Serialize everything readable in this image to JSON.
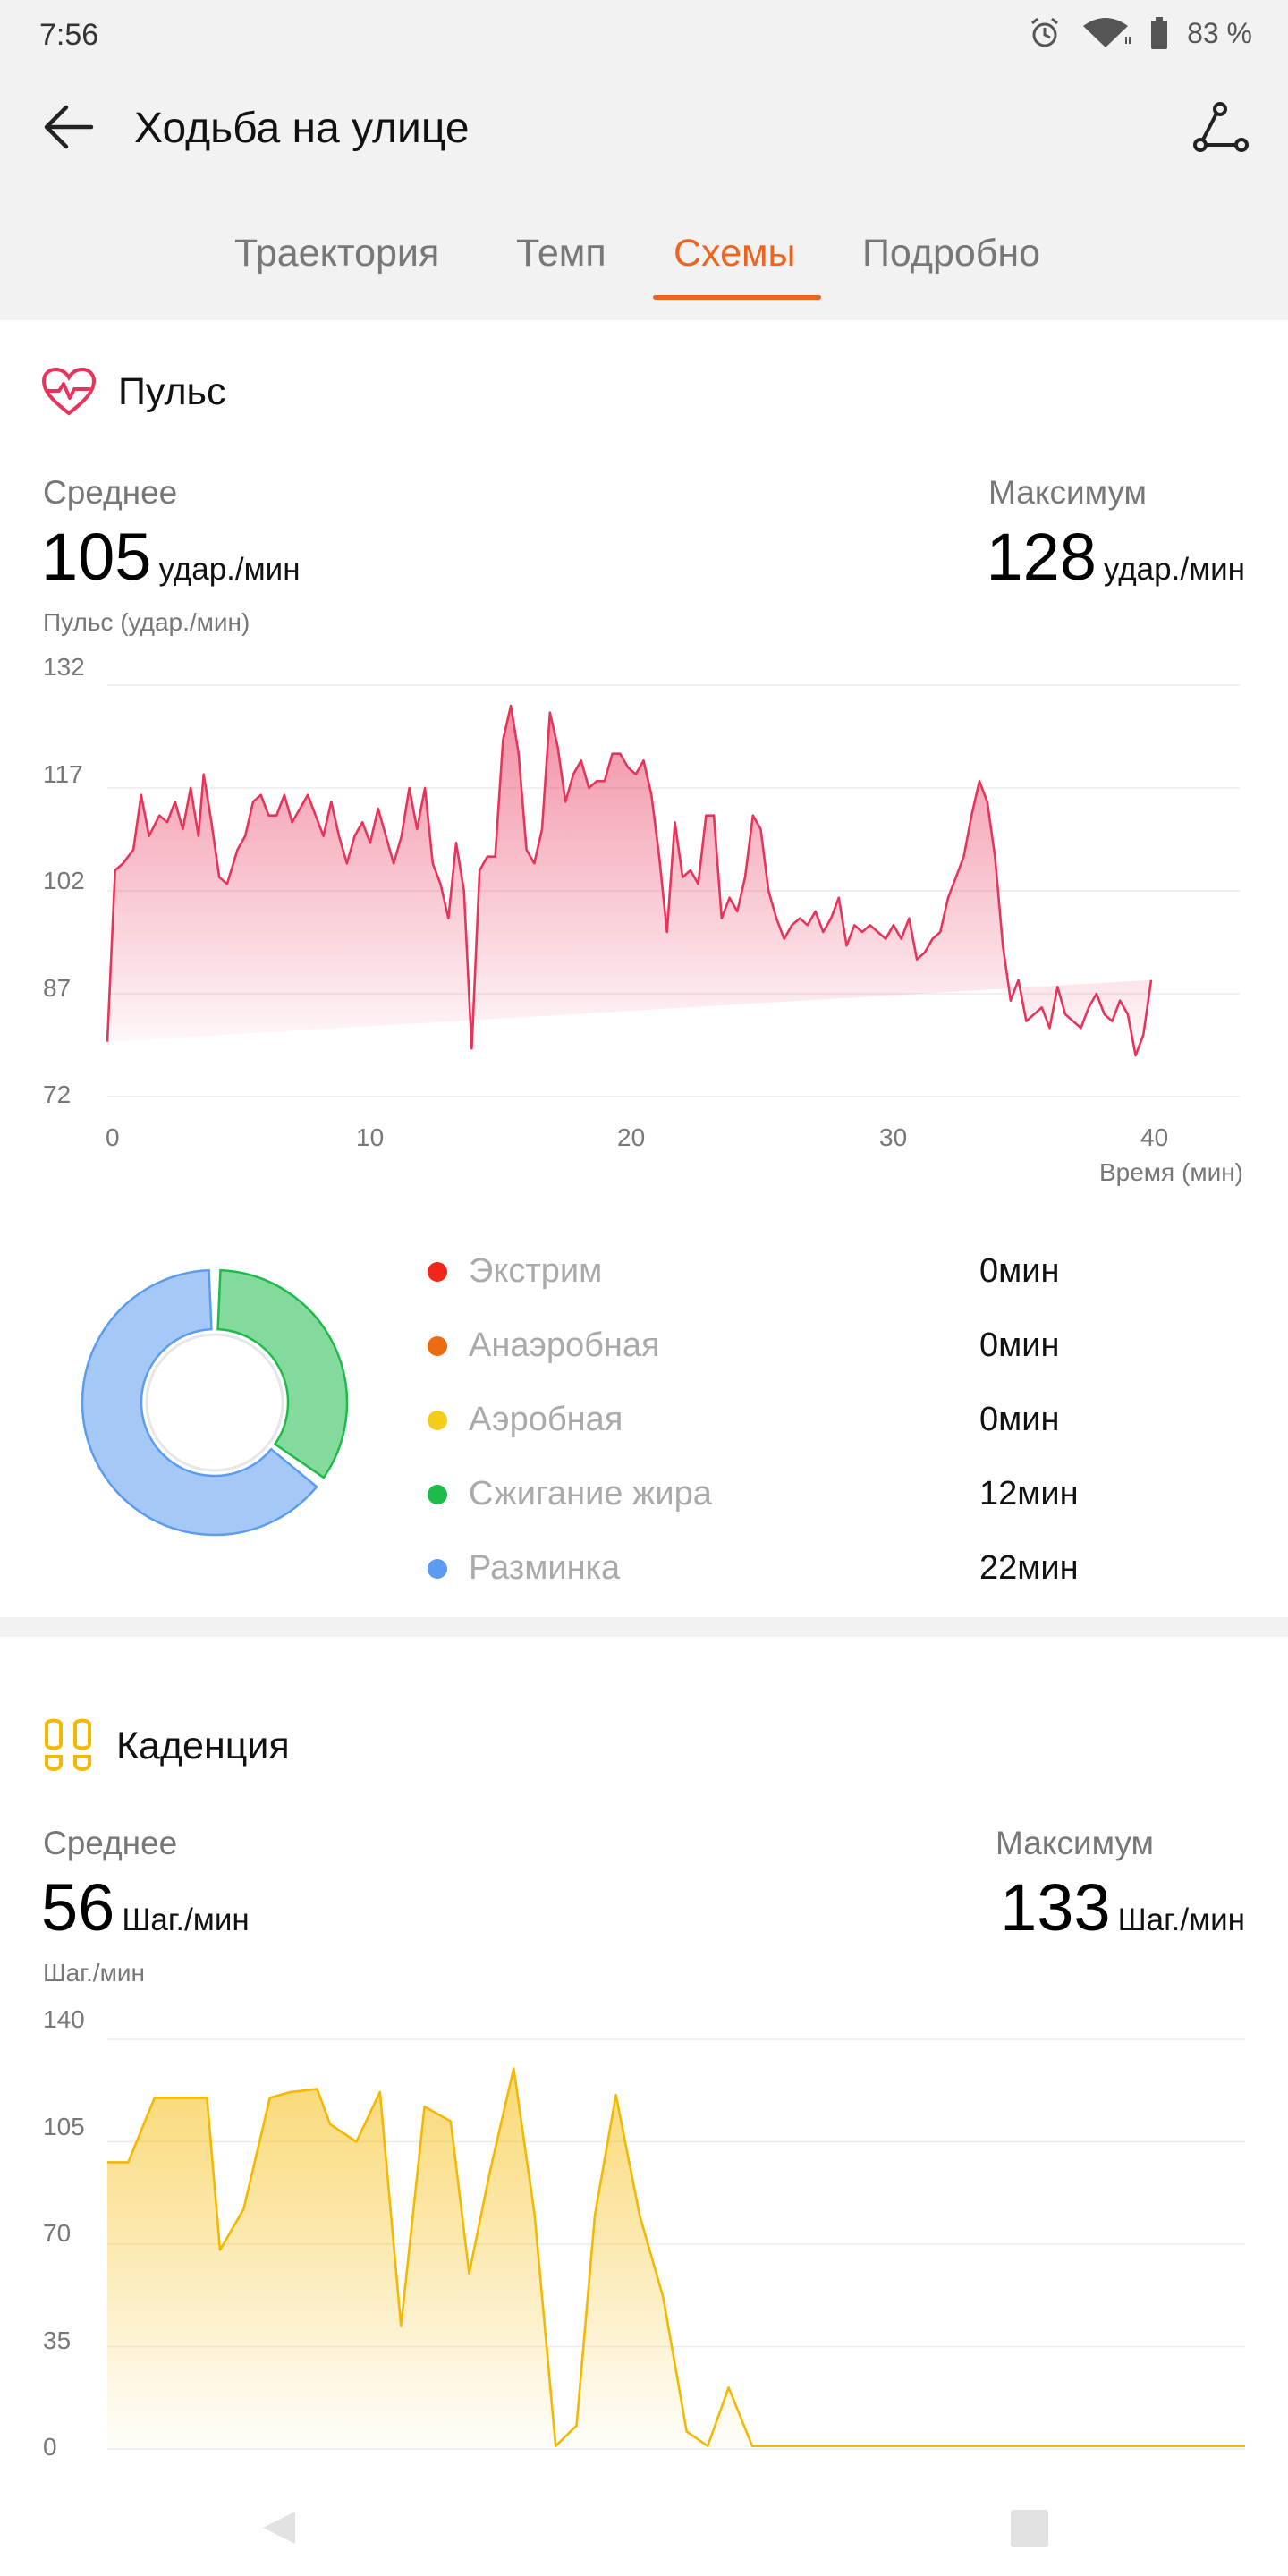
{
  "status": {
    "time": "7:56",
    "battery": "83 %"
  },
  "header": {
    "title": "Ходьба на улице"
  },
  "tabs": [
    {
      "label": "Траектория"
    },
    {
      "label": "Темп"
    },
    {
      "label": "Схемы"
    },
    {
      "label": "Подробно"
    }
  ],
  "active_tab": "Схемы",
  "colors": {
    "accent": "#f0631c",
    "pulse": "#e8345a",
    "cadence": "#f5b800",
    "fat_burn": "#1dbb4a",
    "warmup": "#5b9bf0"
  },
  "pulse": {
    "title": "Пульс",
    "avg_label": "Среднее",
    "avg_value": "105",
    "avg_unit": "удар./мин",
    "max_label": "Максимум",
    "max_value": "128",
    "max_unit": "удар./мин",
    "axis_title": "Пульс (удар./мин)",
    "y_ticks": [
      "132",
      "117",
      "102",
      "87",
      "72"
    ],
    "x_ticks": [
      "0",
      "10",
      "20",
      "30",
      "40"
    ],
    "x_label": "Время (мин)"
  },
  "zones": [
    {
      "label": "Экстрим",
      "value": "0мин",
      "color": "#f3261a"
    },
    {
      "label": "Анаэробная",
      "value": "0мин",
      "color": "#ee6a10"
    },
    {
      "label": "Аэробная",
      "value": "0мин",
      "color": "#f6cc1b"
    },
    {
      "label": "Сжигание жира",
      "value": "12мин",
      "color": "#1dbb4a"
    },
    {
      "label": "Разминка",
      "value": "22мин",
      "color": "#5b9bf0"
    }
  ],
  "cadence": {
    "title": "Каденция",
    "avg_label": "Среднее",
    "avg_value": "56",
    "avg_unit": "Шаг./мин",
    "max_label": "Максимум",
    "max_value": "133",
    "max_unit": "Шаг./мин",
    "axis_title": "Шаг./мин",
    "y_ticks": [
      "140",
      "105",
      "70",
      "35",
      "0"
    ]
  },
  "chart_data": [
    {
      "type": "area",
      "title": "",
      "ylabel": "Пульс (удар./мин)",
      "xlabel": "Время (мин)",
      "xlim": [
        0,
        43.5
      ],
      "ylim": [
        72,
        132
      ],
      "x": [
        0,
        0.3,
        0.6,
        1,
        1.3,
        1.6,
        2,
        2.3,
        2.6,
        2.9,
        3.2,
        3.5,
        3.7,
        4,
        4.3,
        4.6,
        5,
        5.3,
        5.6,
        5.9,
        6.2,
        6.5,
        6.8,
        7.1,
        7.4,
        7.7,
        8,
        8.3,
        8.6,
        8.9,
        9.2,
        9.5,
        9.8,
        10.1,
        10.4,
        10.7,
        11,
        11.3,
        11.6,
        11.9,
        12.2,
        12.5,
        12.8,
        13.1,
        13.4,
        13.7,
        14,
        14.3,
        14.6,
        14.9,
        15.2,
        15.5,
        15.8,
        16.1,
        16.4,
        16.7,
        17,
        17.3,
        17.6,
        17.9,
        18.2,
        18.5,
        18.8,
        19.1,
        19.4,
        19.7,
        20,
        20.3,
        20.6,
        20.9,
        21.2,
        21.5,
        21.8,
        22.1,
        22.4,
        22.7,
        23,
        23.3,
        23.6,
        23.9,
        24.2,
        24.5,
        24.8,
        25.1,
        25.4,
        25.7,
        26,
        26.3,
        26.6,
        26.9,
        27.2,
        27.5,
        27.8,
        28.1,
        28.4,
        28.7,
        29,
        29.3,
        29.6,
        29.9,
        30.2,
        30.5,
        30.8,
        31.1,
        31.4,
        31.7,
        32,
        32.3,
        32.6,
        32.9,
        33.2,
        33.5,
        33.8,
        34.1,
        34.4,
        34.7,
        35,
        35.3,
        35.6,
        35.9,
        36.2,
        36.5,
        36.8,
        37.1,
        37.4,
        37.7,
        38,
        38.3,
        38.6,
        38.9,
        39.2,
        39.5,
        39.8,
        40.1,
        40.4,
        40.7,
        41,
        41.3,
        41.6,
        41.9,
        42.2,
        42.5,
        42.8,
        43.1,
        43.4
      ],
      "values": [
        80,
        105,
        106,
        108,
        116,
        110,
        113,
        112,
        115,
        111,
        117,
        110,
        119,
        112,
        104,
        103,
        108,
        110,
        115,
        116,
        113,
        113,
        116,
        112,
        114,
        116,
        113,
        110,
        115,
        110,
        106,
        110,
        112,
        109,
        114,
        110,
        106,
        110,
        117,
        111,
        117,
        106,
        103,
        98,
        109,
        102,
        79,
        105,
        107,
        107,
        124,
        129,
        122,
        108,
        106,
        111,
        128,
        123,
        115,
        119,
        121,
        117,
        118,
        118,
        122,
        122,
        120,
        119,
        121,
        116,
        107,
        96,
        112,
        104,
        105,
        103,
        113,
        113,
        98,
        101,
        99,
        104,
        113,
        111,
        102,
        98,
        95,
        97,
        98,
        97,
        99,
        96,
        98,
        101,
        94,
        97,
        96,
        97,
        96,
        95,
        97,
        95,
        98,
        92,
        93,
        95,
        96,
        101,
        104,
        107,
        113,
        118,
        115,
        107,
        94,
        86,
        89,
        83,
        84,
        85,
        82,
        88,
        84,
        83,
        82,
        85,
        87,
        84,
        83,
        86,
        84,
        78,
        81,
        89
      ]
    },
    {
      "type": "area",
      "title": "",
      "ylabel": "Шаг./мин",
      "ylim": [
        0,
        140
      ],
      "x": [
        0,
        0.8,
        1.8,
        2.8,
        3.8,
        4.3,
        5.2,
        6.2,
        7,
        8,
        8.5,
        9.5,
        10.4,
        11.2,
        12.1,
        13.1,
        13.8,
        14.6,
        15.5,
        16.3,
        17.1,
        17.9,
        18.6,
        19.4,
        20.3,
        21.2,
        22.1,
        22.9,
        23.7,
        24.6,
        25.4,
        26.2,
        27.1,
        28,
        29,
        30,
        31,
        32,
        33,
        34,
        35,
        36,
        37,
        38,
        39,
        40,
        41,
        42,
        43,
        43.4
      ],
      "values": [
        98,
        98,
        120,
        120,
        120,
        68,
        82,
        120,
        122,
        123,
        111,
        105,
        122,
        42,
        117,
        112,
        60,
        95,
        130,
        80,
        1,
        8,
        80,
        121,
        80,
        52,
        6,
        1,
        21,
        1,
        1,
        1,
        1,
        1,
        1,
        1,
        1,
        1,
        1,
        1,
        1,
        1,
        1,
        1,
        1,
        1,
        1,
        1,
        1,
        1
      ]
    },
    {
      "type": "pie",
      "title": "",
      "categories": [
        "Сжигание жира",
        "Разминка"
      ],
      "values": [
        12,
        22
      ]
    }
  ]
}
